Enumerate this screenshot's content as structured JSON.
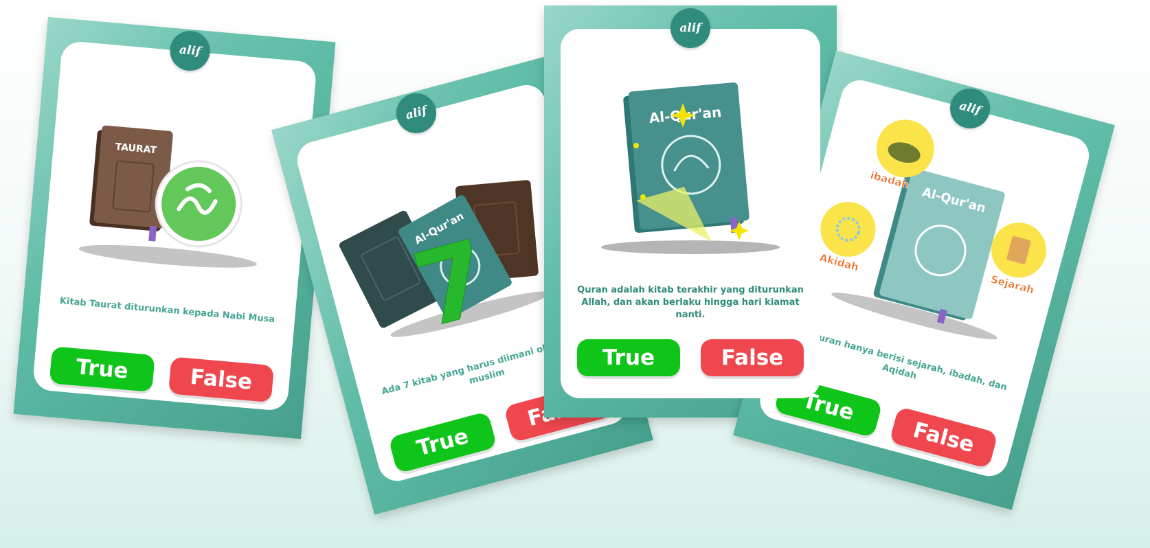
{
  "colors": {
    "card_frame": "#5dbba6",
    "logo_bg": "#2f8c7c",
    "true_button": "#10c51a",
    "false_button": "#f0474f",
    "question_text": "#46a593",
    "tag_text": "#f06a20"
  },
  "logo_label": "alif",
  "cards": [
    {
      "question": "Kitab Taurat diturunkan kepada Nabi Musa",
      "true_label": "True",
      "false_label": "False",
      "illustration": {
        "book_title": "TAURAT",
        "icon": "musa-calligraphy-icon"
      }
    },
    {
      "question": "Ada 7 kitab yang harus diimani oleh umat muslim",
      "true_label": "True",
      "false_label": "False",
      "illustration": {
        "book_title": "Al-Qur'an",
        "number": "7"
      }
    },
    {
      "question": "Quran adalah kitab terakhir yang diturunkan Allah, dan akan berlaku hingga hari kiamat nanti.",
      "true_label": "True",
      "false_label": "False",
      "illustration": {
        "book_title": "Al-Qur'an"
      }
    },
    {
      "question": "Al-Quran hanya berisi sejarah, ibadah, dan Aqidah",
      "true_label": "True",
      "false_label": "False",
      "illustration": {
        "book_title": "Al-Qur'an",
        "tags": [
          "ibadah",
          "Akidah",
          "Sejarah"
        ]
      }
    }
  ]
}
